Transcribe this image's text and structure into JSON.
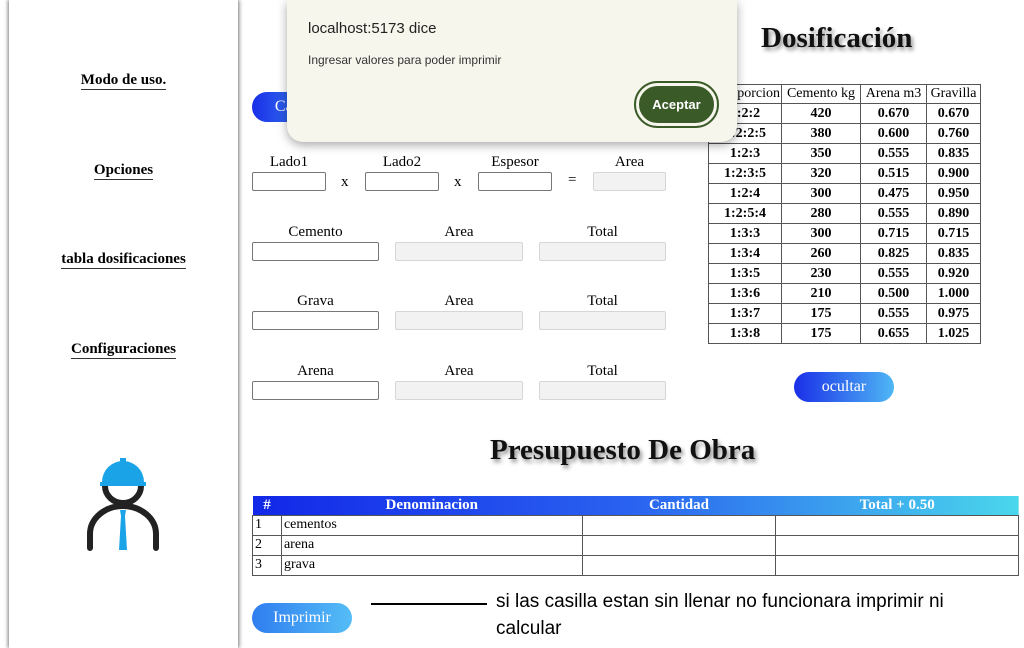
{
  "sidebar": {
    "items": [
      {
        "label": "Modo de uso."
      },
      {
        "label": "Opciones"
      },
      {
        "label": "tabla dosificaciones"
      },
      {
        "label": "Configuraciones"
      }
    ],
    "avatar_icon": "worker-helmet-icon"
  },
  "calc": {
    "calc_button_label": "Calcular",
    "lado1": "Lado1",
    "lado2": "Lado2",
    "espesor": "Espesor",
    "area": "Area",
    "times": "x",
    "equals": "=",
    "rows": [
      {
        "name": "Cemento",
        "area": "Area",
        "total": "Total"
      },
      {
        "name": "Grava",
        "area": "Area",
        "total": "Total"
      },
      {
        "name": "Arena",
        "area": "Area",
        "total": "Total"
      }
    ]
  },
  "dosificacion": {
    "title": "Dosificación",
    "headers": [
      "Proporcion",
      "Cemento kg",
      "Arena m3",
      "Gravilla"
    ],
    "rows": [
      [
        "1:2:2",
        "420",
        "0.670",
        "0.670"
      ],
      [
        "1:2:2:5",
        "380",
        "0.600",
        "0.760"
      ],
      [
        "1:2:3",
        "350",
        "0.555",
        "0.835"
      ],
      [
        "1:2:3:5",
        "320",
        "0.515",
        "0.900"
      ],
      [
        "1:2:4",
        "300",
        "0.475",
        "0.950"
      ],
      [
        "1:2:5:4",
        "280",
        "0.555",
        "0.890"
      ],
      [
        "1:3:3",
        "300",
        "0.715",
        "0.715"
      ],
      [
        "1:3:4",
        "260",
        "0.825",
        "0.835"
      ],
      [
        "1:3:5",
        "230",
        "0.555",
        "0.920"
      ],
      [
        "1:3:6",
        "210",
        "0.500",
        "1.000"
      ],
      [
        "1:3:7",
        "175",
        "0.555",
        "0.975"
      ],
      [
        "1:3:8",
        "175",
        "0.655",
        "1.025"
      ]
    ],
    "hide_button": "ocultar"
  },
  "presupuesto": {
    "title": "Presupuesto De Obra",
    "headers": [
      "#",
      "Denominacion",
      "Cantidad",
      "Total + 0.50"
    ],
    "rows": [
      {
        "num": "1",
        "name": "cementos"
      },
      {
        "num": "2",
        "name": "arena"
      },
      {
        "num": "3",
        "name": "grava"
      }
    ],
    "print_button": "Imprimir"
  },
  "note": "si las casilla estan sin llenar  no funcionara imprimir ni calcular",
  "dialog": {
    "title": "localhost:5173 dice",
    "message": "Ingresar valores para poder imprimir",
    "accept": "Aceptar"
  },
  "colors": {
    "button_gradient_start": "#1a2fe8",
    "button_gradient_end": "#4fb7f5",
    "dialog_bg": "#f6f6ec",
    "accept_bg": "#3a5a28",
    "avatar_helmet": "#1ba3e8"
  }
}
